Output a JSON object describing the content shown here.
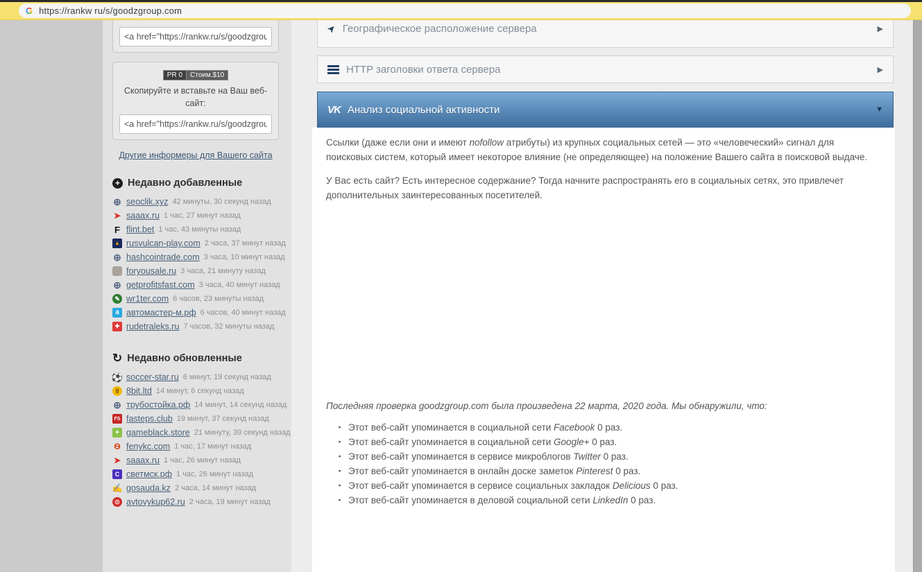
{
  "colors": {
    "browser_bar": "#f6e170",
    "accordion_active_top": "#7aabd6",
    "accordion_active_bottom": "#3f6e9e",
    "sidebar_bg": "#e2e2e2"
  },
  "browser": {
    "url": "https://rankw ru/s/goodzgroup.com"
  },
  "sidebar": {
    "informer_code": "<a href=\"https://rankw.ru/s/goodzgrou",
    "badge": {
      "pr": "PR 0",
      "cost": "Стоим.$10"
    },
    "copy_instruction": "Скопируйте и вставьте на Ваш веб-сайт:",
    "other_informers_link": "Другие информеры для Вашего сайта",
    "recently_added": {
      "title": "Недавно добавленные",
      "icon_glyph": "+",
      "items": [
        {
          "domain": "seoclik.xyz",
          "time": "42 минуты, 30 секунд назад",
          "icon": "globe-icon",
          "glyph": "⊕",
          "fg": "#5a6b85",
          "bg": "transparent",
          "radius": "0",
          "fs": "14px"
        },
        {
          "domain": "saaax.ru",
          "time": "1 час, 27 минут назад",
          "icon": "red-arrow-icon",
          "glyph": "➤",
          "fg": "#d93025",
          "bg": "transparent",
          "radius": "0",
          "fs": "12px"
        },
        {
          "domain": "flint.bet",
          "time": "1 час, 43 минуты назад",
          "icon": "letter-f-icon",
          "glyph": "F",
          "fg": "#111111",
          "bg": "transparent",
          "radius": "0",
          "fs": "13px"
        },
        {
          "domain": "rusvulcan-play.com",
          "time": "2 часа, 37 минут назад",
          "icon": "vulcan-icon",
          "glyph": "▲",
          "fg": "#f0a500",
          "bg": "#1a2a5e",
          "radius": "2px",
          "fs": "8px"
        },
        {
          "domain": "hashcointrade.com",
          "time": "3 часа, 10 минут назад",
          "icon": "globe-icon",
          "glyph": "⊕",
          "fg": "#5a6b85",
          "bg": "transparent",
          "radius": "0",
          "fs": "14px"
        },
        {
          "domain": "foryousale.ru",
          "time": "3 часа, 21 минуту назад",
          "icon": "car-icon",
          "glyph": "",
          "fg": "#ffffff",
          "bg": "#a8a29b",
          "radius": "3px",
          "fs": "9px"
        },
        {
          "domain": "getprofitsfast.com",
          "time": "3 часа, 40 минут назад",
          "icon": "globe-icon",
          "glyph": "⊕",
          "fg": "#5a6b85",
          "bg": "transparent",
          "radius": "0",
          "fs": "14px"
        },
        {
          "domain": "wr1ter.com",
          "time": "6 часов, 23 минуты назад",
          "icon": "pencil-icon",
          "glyph": "✎",
          "fg": "#ffffff",
          "bg": "#2e7d32",
          "radius": "50%",
          "fs": "9px"
        },
        {
          "domain": "автомастер-м.рф",
          "time": "6 часов, 40 минут назад",
          "icon": "letter-a-icon",
          "glyph": "a",
          "fg": "#ffffff",
          "bg": "#29a8e0",
          "radius": "2px",
          "fs": "10px"
        },
        {
          "domain": "rudetraleks.ru",
          "time": "7 часов, 32 минуты назад",
          "icon": "red-square-icon",
          "glyph": "✚",
          "fg": "#ffffff",
          "bg": "#e03a3a",
          "radius": "2px",
          "fs": "8px"
        }
      ]
    },
    "recently_updated": {
      "title": "Недавно обновленные",
      "icon_glyph": "↻",
      "items": [
        {
          "domain": "soccer-star.ru",
          "time": "6 минут, 19 секунд назад",
          "icon": "soccer-ball-icon",
          "glyph": "⚽",
          "fg": "#222222",
          "bg": "transparent",
          "radius": "0",
          "fs": "13px"
        },
        {
          "domain": "8bit.ltd",
          "time": "14 минут, 6 секунд назад",
          "icon": "coin-icon",
          "glyph": "8",
          "fg": "#7a5200",
          "bg": "#f2b705",
          "radius": "50%",
          "fs": "9px"
        },
        {
          "domain": "трубостойка.рф",
          "time": "14 минут, 14 секунд назад",
          "icon": "globe-icon",
          "glyph": "⊕",
          "fg": "#5a6b85",
          "bg": "transparent",
          "radius": "0",
          "fs": "14px"
        },
        {
          "domain": "fasteps.club",
          "time": "19 минут, 37 секунд назад",
          "icon": "fs-logo-icon",
          "glyph": "FS",
          "fg": "#ffffff",
          "bg": "#c62828",
          "radius": "2px",
          "fs": "7px"
        },
        {
          "domain": "gameblack.store",
          "time": "21 минуту, 39 секунд назад",
          "icon": "game-icon",
          "glyph": "✦",
          "fg": "#ffffff",
          "bg": "#8bc34a",
          "radius": "2px",
          "fs": "8px"
        },
        {
          "domain": "fenykc.com",
          "time": "1 час, 17 минут назад",
          "icon": "feny-logo-icon",
          "glyph": "Ѳ",
          "fg": "#d84315",
          "bg": "transparent",
          "radius": "0",
          "fs": "12px"
        },
        {
          "domain": "saaax.ru",
          "time": "1 час, 26 минут назад",
          "icon": "red-arrow-icon",
          "glyph": "➤",
          "fg": "#d93025",
          "bg": "transparent",
          "radius": "0",
          "fs": "12px"
        },
        {
          "domain": "светмск.рф",
          "time": "1 час, 26 минут назад",
          "icon": "cart-icon",
          "glyph": "С",
          "fg": "#ffffff",
          "bg": "#4b2fbd",
          "radius": "2px",
          "fs": "9px"
        },
        {
          "domain": "gosauda.kz",
          "time": "2 часа, 14 минут назад",
          "icon": "hand-pen-icon",
          "glyph": "✍",
          "fg": "#8a8a8a",
          "bg": "transparent",
          "radius": "0",
          "fs": "12px"
        },
        {
          "domain": "avtovykup62.ru",
          "time": "2 часа, 19 минут назад",
          "icon": "red-circle-icon",
          "glyph": "⊙",
          "fg": "#ffffff",
          "bg": "#d32f2f",
          "radius": "50%",
          "fs": "9px"
        }
      ]
    }
  },
  "main": {
    "sections": [
      {
        "title": "Географическое расположение сервера",
        "icon": "location-arrow-icon",
        "chevron": "▶",
        "state": "collapsed"
      },
      {
        "title": "HTTP заголовки ответа сервера",
        "icon": "server-icon",
        "chevron": "▶",
        "state": "collapsed"
      },
      {
        "title": "Анализ социальной активности",
        "icon": "vk-icon",
        "icon_glyph": "VK",
        "chevron": "▼",
        "state": "expanded"
      }
    ],
    "social": {
      "p1_before": "Ссылки (даже если они и имеют ",
      "p1_em": "nofollow",
      "p1_after": " атрибуты) из крупных социальных сетей — это «человеческий» сигнал для поисковых систем, который имеет некоторое влияние (не определяющее) на положение Вашего сайта в поисковой выдаче.",
      "p2": "У Вас есть сайт? Есть интересное содержание? Тогда начните распространять его в социальных сетях, это привлечет дополнительных заинтересованных посетителей.",
      "last_check": "Последняя проверка goodzgroup.com была произведена 22 марта, 2020 года. Мы обнаружили, что:",
      "mentions": [
        {
          "prefix": "Этот веб-сайт упоминается в социальной сети ",
          "network": "Facebook",
          "suffix": " 0 раз."
        },
        {
          "prefix": "Этот веб-сайт упоминается в социальной сети ",
          "network": "Google+",
          "suffix": " 0 раз."
        },
        {
          "prefix": "Этот веб-сайт упоминается в сервисе микроблогов ",
          "network": "Twitter",
          "suffix": " 0 раз."
        },
        {
          "prefix": "Этот веб-сайт упоминается в онлайн доске заметок ",
          "network": "Pinterest",
          "suffix": " 0 раз."
        },
        {
          "prefix": "Этот веб-сайт упоминается в сервисе социальных закладок ",
          "network": "Delicious",
          "suffix": " 0 раз."
        },
        {
          "prefix": "Этот веб-сайт упоминается в деловой социальной сети ",
          "network": "LinkedIn",
          "suffix": " 0 раз."
        }
      ]
    }
  }
}
